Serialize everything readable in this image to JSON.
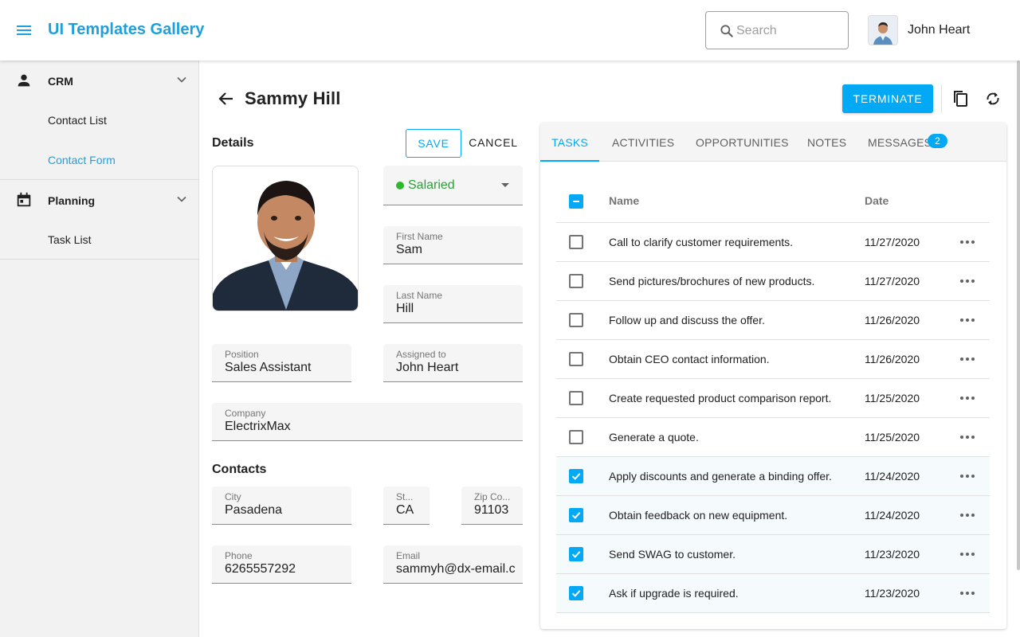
{
  "header": {
    "app_title": "UI Templates Gallery",
    "search_placeholder": "Search",
    "user_name": "John Heart"
  },
  "sidebar": {
    "groups": [
      {
        "label": "CRM",
        "icon": "person-icon",
        "items": [
          {
            "label": "Contact List"
          },
          {
            "label": "Contact Form",
            "active": true
          }
        ]
      },
      {
        "label": "Planning",
        "icon": "calendar-icon",
        "items": [
          {
            "label": "Task List"
          }
        ]
      }
    ]
  },
  "contact": {
    "name": "Sammy Hill",
    "terminate_label": "TERMINATE",
    "details_title": "Details",
    "save_label": "SAVE",
    "cancel_label": "CANCEL",
    "status": "Salaried",
    "status_color": "#2eb82e",
    "first_name_label": "First Name",
    "first_name": "Sam",
    "last_name_label": "Last Name",
    "last_name": "Hill",
    "position_label": "Position",
    "position": "Sales Assistant",
    "assigned_label": "Assigned to",
    "assigned": "John Heart",
    "company_label": "Company",
    "company": "ElectrixMax",
    "contacts_title": "Contacts",
    "city_label": "City",
    "city": "Pasadena",
    "state_label": "St...",
    "state": "CA",
    "zip_label": "Zip Co...",
    "zip": "91103",
    "phone_label": "Phone",
    "phone": "6265557292",
    "email_label": "Email",
    "email": "sammyh@dx-email.c"
  },
  "tabs": {
    "items": [
      "TASKS",
      "ACTIVITIES",
      "OPPORTUNITIES",
      "NOTES",
      "MESSAGES"
    ],
    "active": "TASKS",
    "messages_badge": "2"
  },
  "tasks": {
    "columns": {
      "name": "Name",
      "date": "Date"
    },
    "rows": [
      {
        "text": "Call to clarify customer requirements.",
        "date": "11/27/2020",
        "done": false
      },
      {
        "text": "Send pictures/brochures of new products.",
        "date": "11/27/2020",
        "done": false
      },
      {
        "text": "Follow up and discuss the offer.",
        "date": "11/26/2020",
        "done": false
      },
      {
        "text": "Obtain CEO contact information.",
        "date": "11/26/2020",
        "done": false
      },
      {
        "text": "Create requested product comparison report.",
        "date": "11/25/2020",
        "done": false
      },
      {
        "text": "Generate a quote.",
        "date": "11/25/2020",
        "done": false
      },
      {
        "text": "Apply discounts and generate a binding offer.",
        "date": "11/24/2020",
        "done": true
      },
      {
        "text": "Obtain feedback on new equipment.",
        "date": "11/24/2020",
        "done": true
      },
      {
        "text": "Send SWAG to customer.",
        "date": "11/23/2020",
        "done": true
      },
      {
        "text": "Ask if upgrade is required.",
        "date": "11/23/2020",
        "done": true
      }
    ]
  },
  "colors": {
    "accent": "#03a9f4",
    "brand": "#1ea0de",
    "status_green": "#2eb82e"
  }
}
